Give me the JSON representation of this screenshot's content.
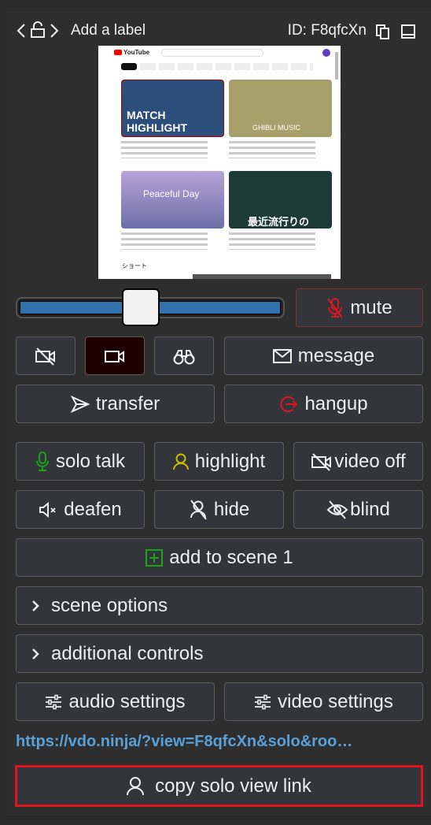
{
  "header": {
    "label": "Add a label",
    "id_text": "ID: F8qfcXn"
  },
  "video": {
    "logo": "YouTube",
    "cards": [
      {
        "title": "MATCH HIGHLIGHT",
        "color": "#2b4f7a"
      },
      {
        "title": "GHIBLI MUSIC",
        "color": "#a8a06a"
      },
      {
        "title": "Peaceful Day",
        "color": "#a99ad0"
      },
      {
        "title": "最近流行りの",
        "color": "#1c3a36"
      }
    ],
    "shorts_label": "ショート"
  },
  "volume": {
    "level_percent": 46
  },
  "buttons": {
    "mute": "mute",
    "message": "message",
    "transfer": "transfer",
    "hangup": "hangup",
    "solo_talk": "solo talk",
    "highlight": "highlight",
    "video_off": "video off",
    "deafen": "deafen",
    "hide": "hide",
    "blind": "blind",
    "add_to_scene": "add to scene 1",
    "scene_options": "scene options",
    "additional_controls": "additional controls",
    "audio_settings": "audio settings",
    "video_settings": "video settings",
    "copy_solo": "copy solo view link"
  },
  "link": "https://vdo.ninja/?view=F8qfcXn&solo&roo…",
  "colors": {
    "accent_red": "#e0141e",
    "green": "#1aa31a",
    "yellow": "#c8c000",
    "link": "#5aa0d8",
    "slider": "#3272aa"
  }
}
